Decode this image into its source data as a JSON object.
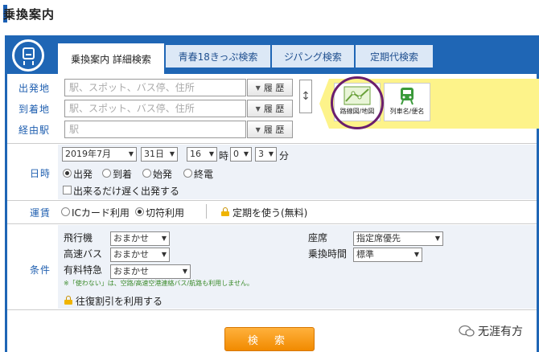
{
  "page_title": "乗換案内",
  "tabs": [
    {
      "label": "乗換案内 詳細検索",
      "active": true
    },
    {
      "label": "青春18きっぷ検索",
      "active": false
    },
    {
      "label": "ジパング検索",
      "active": false
    },
    {
      "label": "定期代検索",
      "active": false
    }
  ],
  "route": {
    "departure_label": "出発地",
    "arrival_label": "到着地",
    "via_label": "経由駅",
    "placeholder_station": "駅、スポット、バス停、住所",
    "placeholder_via": "駅",
    "history_label": "履 歴"
  },
  "side_buttons": {
    "map_label": "路線図/地図",
    "train_label": "列車名/便名"
  },
  "datetime": {
    "label": "日時",
    "year_month": "2019年7月",
    "day": "31日",
    "hour": "16",
    "hour_unit": "時",
    "minute_tens": "0",
    "minute_ones": "3",
    "minute_unit": "分",
    "options": [
      "出発",
      "到着",
      "始発",
      "終電"
    ],
    "selected": "出発",
    "late_departure": "出来るだけ遅く出発する"
  },
  "fare": {
    "label": "運賃",
    "options": [
      "ICカード利用",
      "切符利用"
    ],
    "selected": "切符利用",
    "commuter": "定期を使う(無料)"
  },
  "conditions": {
    "label": "条件",
    "airplane_label": "飛行機",
    "airplane_value": "おまかせ",
    "highway_bus_label": "高速バス",
    "highway_bus_value": "おまかせ",
    "limited_express_label": "有料特急",
    "limited_express_value": "おまかせ",
    "seat_label": "座席",
    "seat_value": "指定席優先",
    "transfer_time_label": "乗換時間",
    "transfer_time_value": "標準",
    "note": "※「使わない」は、空路/高速空港連絡バス/航路も利用しません。",
    "round_trip_discount": "往復割引を利用する"
  },
  "search_button": "検 索",
  "watermark": "无涯有方",
  "colors": {
    "brand_blue": "#1f66b5",
    "accent_orange": "#f18a00",
    "highlight_yellow": "#fdf38a"
  }
}
